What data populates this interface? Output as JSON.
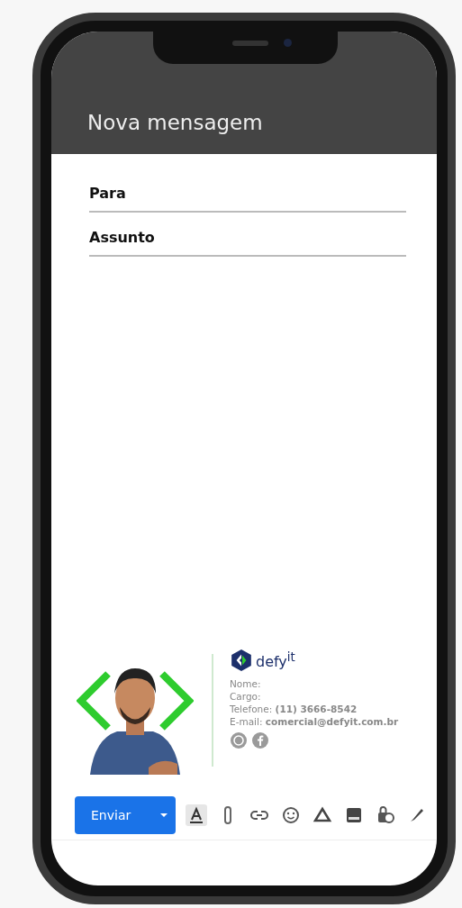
{
  "header": {
    "title": "Nova mensagem"
  },
  "fields": [
    {
      "label": "Para"
    },
    {
      "label": "Assunto"
    }
  ],
  "signature": {
    "logo": "defy$^{it}$",
    "lines": [
      {
        "text": "Nome:"
      },
      {
        "text": "Cargo:"
      },
      {
        "text": "Telefone: **(11) 3666-8542**"
      },
      {
        "text": "E-mail: **comercial@defyit.com.br**"
      }
    ]
  },
  "toolbar": {
    "send": "Enviar"
  }
}
